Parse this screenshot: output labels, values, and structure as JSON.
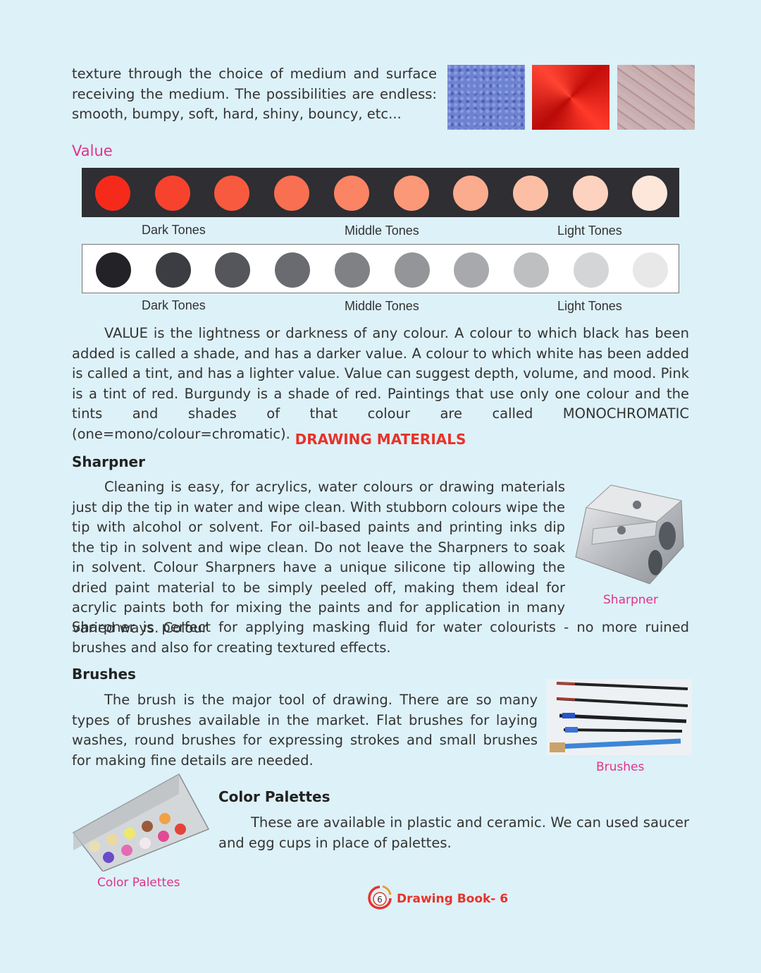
{
  "texture": {
    "text": "texture through the choice of medium and surface receiving the medium. The possibilities are endless: smooth, bumpy, soft, hard, shiny, bouncy, etc..."
  },
  "value_section": {
    "title": "Value",
    "color_strip": {
      "colors": [
        "#f52a1b",
        "#f7432d",
        "#f85a3f",
        "#f96f52",
        "#fa8464",
        "#fa9878",
        "#fbab8e",
        "#fcbfa6",
        "#fdd2bf",
        "#fde6da"
      ],
      "labels": {
        "dark": "Dark Tones",
        "middle": "Middle Tones",
        "light": "Light Tones"
      }
    },
    "gray_strip": {
      "colors": [
        "#222227",
        "#3c3d42",
        "#55565b",
        "#6a6b70",
        "#808184",
        "#949598",
        "#a8a9ac",
        "#bebfc1",
        "#d4d5d6",
        "#e8e8e9"
      ],
      "labels": {
        "dark": "Dark Tones",
        "middle": "Middle Tones",
        "light": "Light Tones"
      }
    },
    "description": "VALUE is the lightness or darkness of any colour. A colour to which black has been added is called a shade, and has a darker value. A colour to which white has been added is called a tint, and has a lighter value. Value can suggest depth, volume, and mood. Pink is a tint of red. Burgundy is a shade of red. Paintings that use only one colour and the tints and shades of that colour are called MONOCHROMATIC (one=mono/colour=chromatic)."
  },
  "materials": {
    "title": "DRAWING MATERIALS",
    "sharpner": {
      "heading": "Sharpner",
      "text": "Cleaning is easy, for acrylics, water colours or drawing materials just dip the tip in water and wipe clean. With stubborn colours wipe the tip with alcohol or solvent. For oil-based paints and printing inks dip the tip in solvent and wipe clean. Do not leave the Sharpners to soak in solvent. Colour Sharpners have a unique silicone tip allowing the dried paint material to be simply peeled off, making them ideal for acrylic paints both for mixing the paints and for application in many varied ways. Colour",
      "text_cont": "Sharpner is perfect for applying masking fluid for water colourists - no more ruined brushes and also for creating textured effects.",
      "caption": "Sharpner"
    },
    "brushes": {
      "heading": "Brushes",
      "text": "The brush is the major tool of drawing. There are so many types of brushes available in the market. Flat brushes for laying washes, round brushes for expressing strokes and small brushes for making fine details are needed.",
      "caption": "Brushes"
    },
    "palettes": {
      "heading": "Color Palettes",
      "text": "These are available in plastic and ceramic. We can used saucer and egg cups in place of palettes.",
      "caption": "Color Palettes"
    }
  },
  "footer": {
    "page_number": "6",
    "book_title": "Drawing Book- 6"
  },
  "colors": {
    "accent_red": "#e8322a",
    "caption_pink": "#e0338a",
    "background": "#ddf1f8"
  }
}
